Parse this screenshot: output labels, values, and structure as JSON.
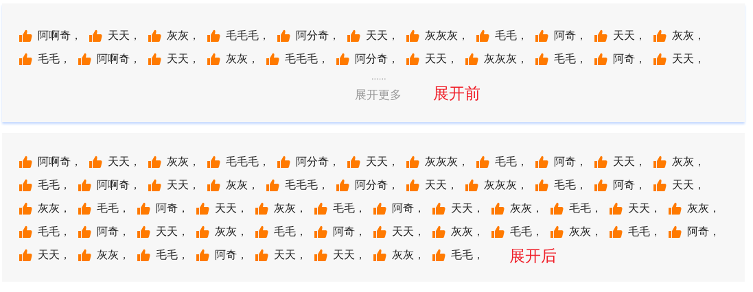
{
  "panels": [
    {
      "rows": [
        [
          "阿啊奇，",
          "天天，",
          "灰灰，",
          "毛毛毛，",
          "阿分奇，",
          "天天，",
          "灰灰灰，",
          "毛毛，",
          "阿奇，",
          "天天，",
          "灰灰，"
        ],
        [
          "毛毛，",
          "阿啊奇，",
          "天天，",
          "灰灰，",
          "毛毛毛，",
          "阿分奇，",
          "天天，",
          "灰灰灰，",
          "毛毛，",
          "阿奇，",
          "天天，"
        ]
      ],
      "ellipsis": "......",
      "expand_link": "展开更多",
      "caption": "展开前"
    },
    {
      "rows": [
        [
          "阿啊奇，",
          "天天，",
          "灰灰，",
          "毛毛毛，",
          "阿分奇，",
          "天天，",
          "灰灰灰，",
          "毛毛，",
          "阿奇，",
          "天天，",
          "灰灰，"
        ],
        [
          "毛毛，",
          "阿啊奇，",
          "天天，",
          "灰灰，",
          "毛毛毛，",
          "阿分奇，",
          "天天，",
          "灰灰灰，",
          "毛毛，",
          "阿奇，",
          "天天，"
        ],
        [
          "灰灰，",
          "毛毛，",
          "阿奇，",
          "天天，",
          "灰灰，",
          "毛毛，",
          "阿奇，",
          "天天，",
          "灰灰，",
          "毛毛，",
          "天天，",
          "灰灰，"
        ],
        [
          "毛毛，",
          "阿奇，",
          "天天，",
          "灰灰，",
          "毛毛，",
          "阿奇，",
          "天天，",
          "灰灰，",
          "毛毛，",
          "灰灰，",
          "毛毛，",
          "阿奇，"
        ],
        [
          "天天，",
          "灰灰，",
          "毛毛，",
          "阿奇，",
          "天天，",
          "天天，",
          "灰灰，",
          "毛毛，"
        ]
      ],
      "caption": "展开后"
    }
  ]
}
